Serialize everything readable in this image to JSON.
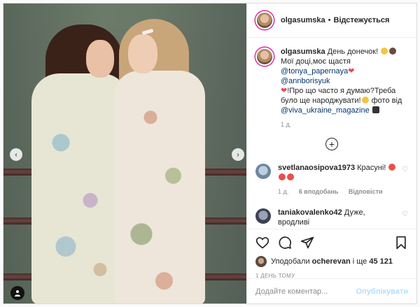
{
  "header": {
    "username": "olgasumska",
    "separator": "•",
    "follow_label": "Відстежується"
  },
  "caption": {
    "username": "olgasumska",
    "text_1": "День донечок!",
    "text_2": "Мої доці,моє щастя",
    "mention_1": "@tonya_papernaya",
    "mention_2": "@annborisyuk",
    "text_3": "!Про що часто я думаю?Треба було ще народжувати!",
    "text_4": "фото від",
    "mention_3": "@viva_ukraine_magazine",
    "time": "1 д."
  },
  "load_more_label": "+",
  "comments": [
    {
      "username": "svetlanaosipova1973",
      "text": "Красуні!",
      "time": "1 д.",
      "likes": "6 вподобань",
      "reply_label": "Відповісти"
    },
    {
      "username": "taniakovalenko42",
      "text": "Дуже, вродливі"
    }
  ],
  "likes": {
    "prefix": "Уподобали",
    "user": "ocherevan",
    "suffix_1": "і ще",
    "count": "45 121"
  },
  "date": "1 ДЕНЬ ТОМУ",
  "composer": {
    "placeholder": "Додайте коментар...",
    "publish_label": "Опублікувати"
  },
  "colors": {
    "link": "#00376b",
    "heart": "#ed4956",
    "publish_disabled": "#b2dffc",
    "muted": "#8e8e8e"
  },
  "icons": [
    "chevron-left-icon",
    "chevron-right-icon",
    "user-tag-icon",
    "heart-icon",
    "comment-icon",
    "share-icon",
    "bookmark-icon",
    "plus-circle-icon"
  ]
}
